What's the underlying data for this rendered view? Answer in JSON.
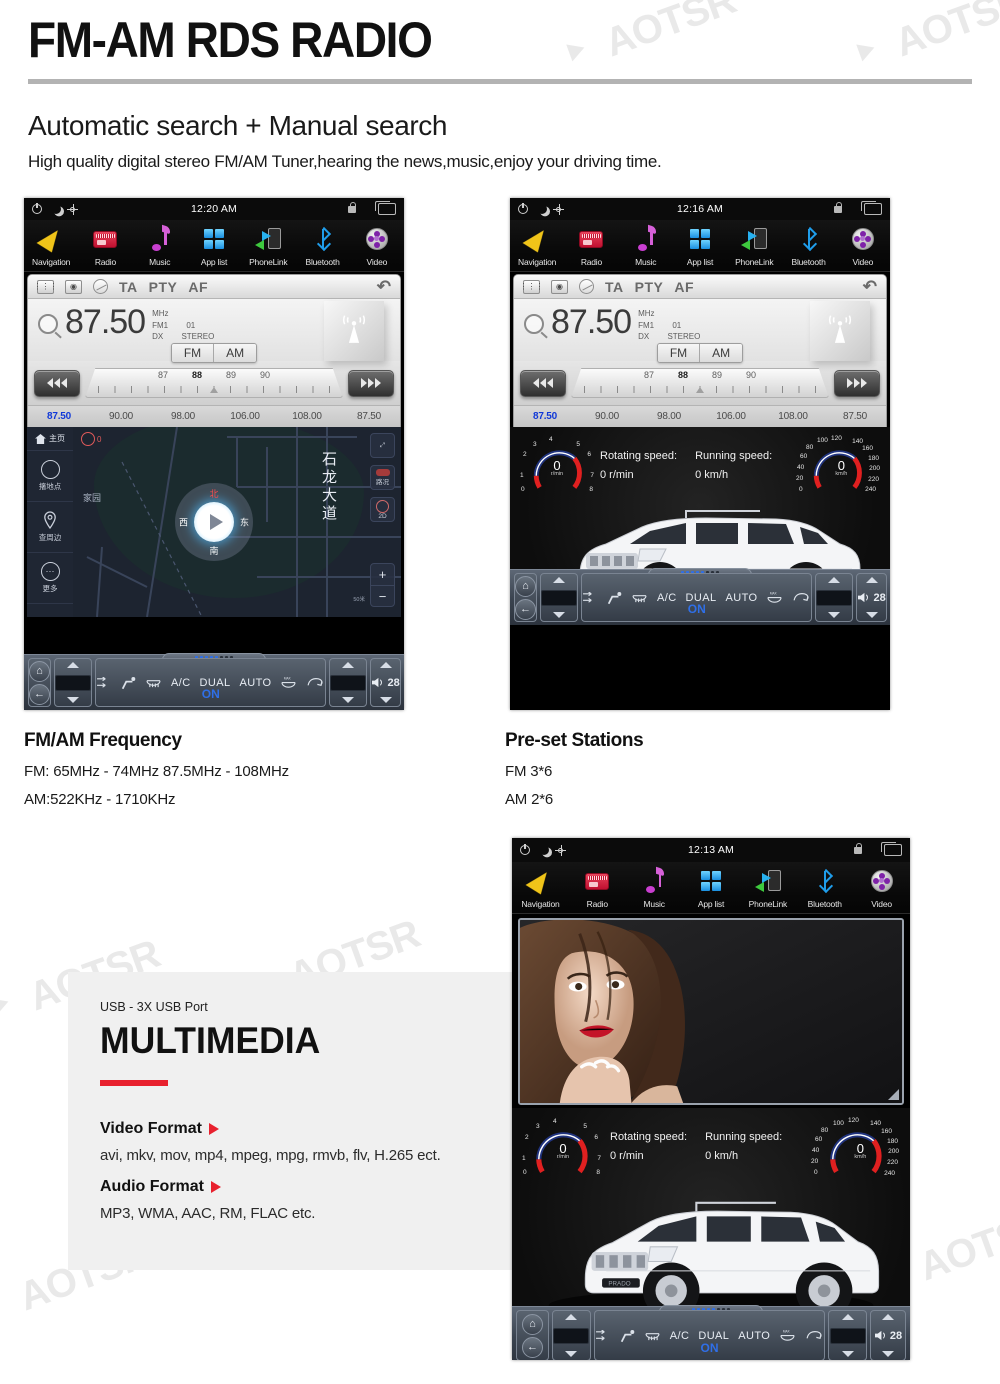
{
  "header": {
    "title": "FM-AM RDS RADIO",
    "subtitle": "Automatic search + Manual search",
    "description": "High quality digital stereo FM/AM Tuner,hearing the news,music,enjoy your driving time."
  },
  "watermark": {
    "text": "AOTSR"
  },
  "accent": {
    "red": "#e8212e",
    "blue": "#1038d8",
    "amber": "#f0c419"
  },
  "dock": {
    "items": [
      {
        "label": "Navigation",
        "icon": "navigation-arrow-icon"
      },
      {
        "label": "Radio",
        "icon": "radio-icon"
      },
      {
        "label": "Music",
        "icon": "music-note-icon"
      },
      {
        "label": "App list",
        "icon": "apps-grid-icon"
      },
      {
        "label": "PhoneLink",
        "icon": "phone-link-icon"
      },
      {
        "label": "Bluetooth",
        "icon": "bluetooth-icon"
      },
      {
        "label": "Video",
        "icon": "video-disc-icon"
      }
    ]
  },
  "status_bar": {
    "power_icon": "power-icon",
    "night_icon": "moon-icon",
    "brightness_icon": "sun-icon",
    "lock_icon": "lock-icon",
    "window_icon": "window-icon",
    "clock_device1": "12:20 AM",
    "clock_device2": "12:16 AM",
    "clock_device3": "12:13 AM"
  },
  "radio": {
    "toolbar": {
      "eq": "eq-icon",
      "preset": "preset-icon",
      "scan": "scan-icon",
      "ta": "TA",
      "pty": "PTY",
      "af": "AF",
      "back": "↶"
    },
    "frequency": "87.50",
    "unit": "MHz",
    "band_slot": "FM1",
    "preset_no": "01",
    "dx": "DX",
    "stereo": "STEREO",
    "bands": [
      "FM",
      "AM"
    ],
    "scale_ticks": [
      "87",
      "88",
      "89",
      "90"
    ],
    "scale_active": "88",
    "presets": [
      "87.50",
      "90.00",
      "98.00",
      "106.00",
      "108.00",
      "87.50"
    ],
    "preset_active_index": 0,
    "tower_icon": "radio-tower-icon",
    "search_icon": "magnifier-icon",
    "seek_prev_icon": "seek-backward-icon",
    "seek_next_icon": "seek-forward-icon"
  },
  "map": {
    "home_label": "主页",
    "sidebar": [
      {
        "label": "撦地点",
        "icon": "search-place-icon"
      },
      {
        "label": "查周边",
        "icon": "pin-nearby-icon"
      },
      {
        "label": "更多",
        "icon": "more-dots-icon"
      }
    ],
    "street_name": "石龙大道",
    "poi_1": "家园",
    "mute_count": "0",
    "compass": {
      "n": "北",
      "s": "南",
      "e": "东",
      "w": "西"
    },
    "traffic_label": "路况",
    "view_label": "2D",
    "scale_label": "50米",
    "zoom_in": "+",
    "zoom_out": "−",
    "expand_icon": "fullscreen-icon"
  },
  "dashboard": {
    "tach": {
      "value": "0",
      "unit": "r/min",
      "ticks": [
        "0",
        "1",
        "2",
        "3",
        "4",
        "5",
        "6",
        "7",
        "8"
      ]
    },
    "speedo": {
      "value": "0",
      "unit": "km/h",
      "ticks": [
        "0",
        "20",
        "40",
        "60",
        "80",
        "100",
        "120",
        "140",
        "160",
        "180",
        "200",
        "220",
        "240"
      ]
    },
    "rotating_label": "Rotating speed:",
    "rotating_value": "0 r/min",
    "running_label": "Running speed:",
    "running_value": "0 km/h",
    "car_badge": "PRADO"
  },
  "climate": {
    "home_icon": "home-icon",
    "back_icon": "back-arrow-icon",
    "labels": {
      "ac": "A/C",
      "dual": "DUAL",
      "auto": "AUTO",
      "on": "ON",
      "max": "MAX"
    },
    "volume": "28",
    "volume_icon": "speaker-icon",
    "defrost_front_icon": "front-defrost-icon",
    "defrost_rear_icon": "rear-defrost-icon",
    "recirculate_icon": "air-recirculate-icon",
    "airflow_icon": "airflow-icon",
    "seat_icon": "seat-airflow-icon"
  },
  "captions": {
    "left": {
      "heading": "FM/AM Frequency",
      "line1": "FM: 65MHz - 74MHz    87.5MHz - 108MHz",
      "line2": "AM:522KHz - 1710KHz"
    },
    "right": {
      "heading": "Pre-set Stations",
      "line1": "FM 3*6",
      "line2": "AM 2*6"
    }
  },
  "multimedia": {
    "usb": "USB - 3X USB Port",
    "title": "MULTIMEDIA",
    "video_label": "Video Format",
    "video_value": "avi, mkv, mov, mp4, mpeg, mpg, rmvb, flv, H.265 ect.",
    "audio_label": "Audio Format",
    "audio_value": "MP3, WMA, AAC, RM, FLAC etc."
  }
}
